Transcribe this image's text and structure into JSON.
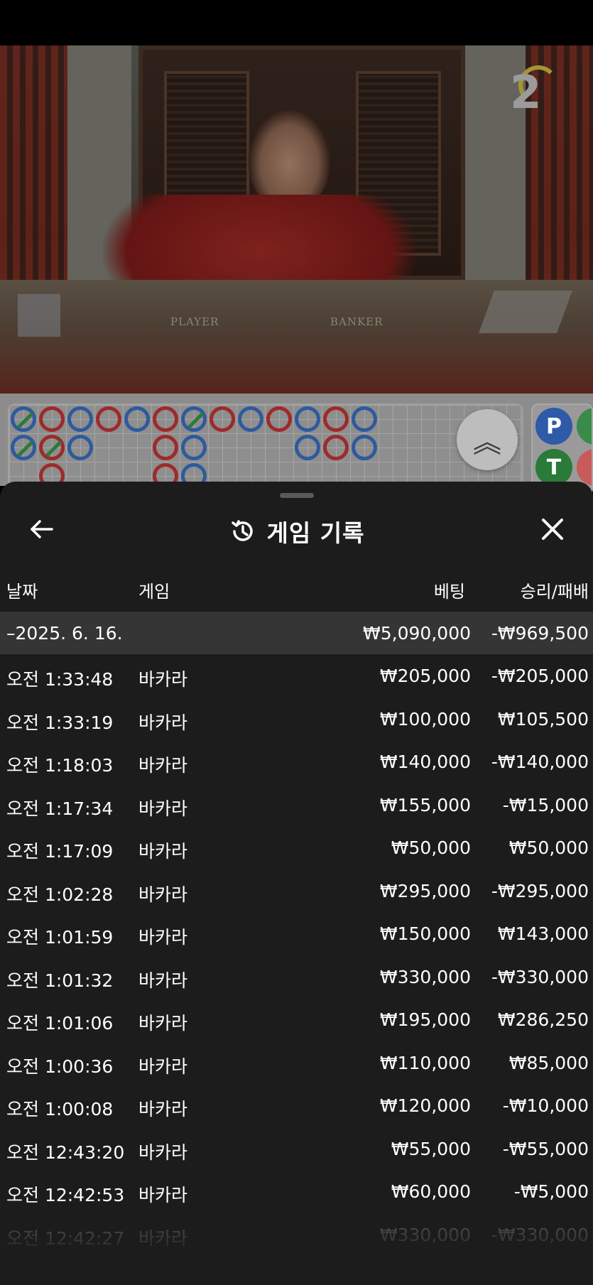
{
  "camera": {
    "number": "2"
  },
  "table_labels": {
    "player": "PLAYER",
    "banker": "BANKER"
  },
  "side_tiles": [
    {
      "letter": "P",
      "color": "#2e5aa8"
    },
    {
      "letter": "T",
      "color": "#2a7a3a"
    }
  ],
  "header": {
    "title": "게임 기록",
    "back_icon": "arrow-left-icon",
    "history_icon": "history-icon",
    "close_icon": "close-icon"
  },
  "columns": {
    "date": "날짜",
    "game": "게임",
    "bet": "베팅",
    "win_loss": "승리/패배"
  },
  "group": {
    "date": "–2025. 6. 16.",
    "bet": "₩5,090,000",
    "win_loss": "-₩969,500"
  },
  "rows": [
    {
      "time": "오전 1:33:48",
      "game": "바카라",
      "bet": "₩205,000",
      "win_loss": "-₩205,000"
    },
    {
      "time": "오전 1:33:19",
      "game": "바카라",
      "bet": "₩100,000",
      "win_loss": "₩105,500"
    },
    {
      "time": "오전 1:18:03",
      "game": "바카라",
      "bet": "₩140,000",
      "win_loss": "-₩140,000"
    },
    {
      "time": "오전 1:17:34",
      "game": "바카라",
      "bet": "₩155,000",
      "win_loss": "-₩15,000"
    },
    {
      "time": "오전 1:17:09",
      "game": "바카라",
      "bet": "₩50,000",
      "win_loss": "₩50,000"
    },
    {
      "time": "오전 1:02:28",
      "game": "바카라",
      "bet": "₩295,000",
      "win_loss": "-₩295,000"
    },
    {
      "time": "오전 1:01:59",
      "game": "바카라",
      "bet": "₩150,000",
      "win_loss": "₩143,000"
    },
    {
      "time": "오전 1:01:32",
      "game": "바카라",
      "bet": "₩330,000",
      "win_loss": "-₩330,000"
    },
    {
      "time": "오전 1:01:06",
      "game": "바카라",
      "bet": "₩195,000",
      "win_loss": "₩286,250"
    },
    {
      "time": "오전 1:00:36",
      "game": "바카라",
      "bet": "₩110,000",
      "win_loss": "₩85,000"
    },
    {
      "time": "오전 1:00:08",
      "game": "바카라",
      "bet": "₩120,000",
      "win_loss": "-₩10,000"
    },
    {
      "time": "오전 12:43:20",
      "game": "바카라",
      "bet": "₩55,000",
      "win_loss": "-₩55,000"
    },
    {
      "time": "오전 12:42:53",
      "game": "바카라",
      "bet": "₩60,000",
      "win_loss": "-₩5,000"
    },
    {
      "time": "오전 12:42:27",
      "game": "바카라",
      "bet": "₩330,000",
      "win_loss": "-₩330,000"
    }
  ]
}
